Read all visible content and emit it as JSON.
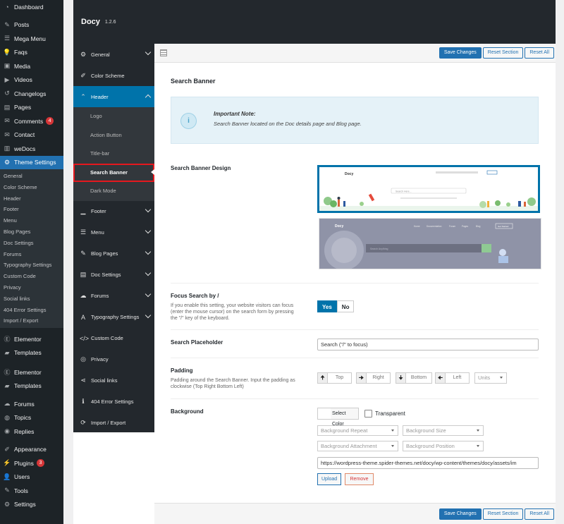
{
  "wp_menu": {
    "items": [
      {
        "label": "Dashboard",
        "icon": "dashboard-icon",
        "glyph": "◔"
      },
      {
        "sep": true
      },
      {
        "label": "Posts",
        "icon": "pin-icon",
        "glyph": "✎"
      },
      {
        "label": "Mega Menu",
        "icon": "menu-icon",
        "glyph": "☰"
      },
      {
        "label": "Faqs",
        "icon": "lightbulb-icon",
        "glyph": "💡"
      },
      {
        "label": "Media",
        "icon": "media-icon",
        "glyph": "▣"
      },
      {
        "label": "Videos",
        "icon": "video-icon",
        "glyph": "▶"
      },
      {
        "label": "Changelogs",
        "icon": "history-icon",
        "glyph": "↺"
      },
      {
        "label": "Pages",
        "icon": "pages-icon",
        "glyph": "▤"
      },
      {
        "label": "Comments",
        "icon": "comments-icon",
        "glyph": "✉",
        "badge": "4"
      },
      {
        "label": "Contact",
        "icon": "mail-icon",
        "glyph": "✉"
      },
      {
        "label": "weDocs",
        "icon": "book-icon",
        "glyph": "▥"
      },
      {
        "label": "Theme Settings",
        "icon": "gear-icon",
        "glyph": "⚙",
        "active": true
      }
    ],
    "theme_submenu": [
      "General",
      "Color Scheme",
      "Header",
      "Footer",
      "Menu",
      "Blog Pages",
      "Doc Settings",
      "Forums",
      "Typography Settings",
      "Custom Code",
      "Privacy",
      "Social links",
      "404 Error Settings",
      "Import / Export"
    ],
    "items_after": [
      {
        "sep": true
      },
      {
        "label": "Elementor",
        "icon": "elementor-icon",
        "glyph": "Ⓔ"
      },
      {
        "label": "Templates",
        "icon": "folder-icon",
        "glyph": "▰"
      },
      {
        "label": "",
        "icon": "cut-item-icon",
        "glyph": "",
        "partial": true
      },
      {
        "label": "Elementor",
        "icon": "elementor-icon",
        "glyph": "Ⓔ"
      },
      {
        "label": "Templates",
        "icon": "folder-icon",
        "glyph": "▰"
      },
      {
        "sep": true
      },
      {
        "label": "Forums",
        "icon": "forums-icon",
        "glyph": "☁"
      },
      {
        "label": "Topics",
        "icon": "topics-icon",
        "glyph": "◍"
      },
      {
        "label": "Replies",
        "icon": "replies-icon",
        "glyph": "◉"
      },
      {
        "sep": true
      },
      {
        "label": "Appearance",
        "icon": "brush-icon",
        "glyph": "✐"
      },
      {
        "label": "Plugins",
        "icon": "plugin-icon",
        "glyph": "⚡",
        "badge": "3"
      },
      {
        "label": "Users",
        "icon": "user-icon",
        "glyph": "👤"
      },
      {
        "label": "Tools",
        "icon": "wrench-icon",
        "glyph": "✎"
      },
      {
        "label": "Settings",
        "icon": "settings-icon",
        "glyph": "⚙"
      }
    ]
  },
  "panel": {
    "title": "Docy",
    "version": "1.2.6"
  },
  "options_nav": {
    "before": [
      {
        "label": "General",
        "icon": "gear-icon",
        "glyph": "⚙",
        "chev": true
      },
      {
        "label": "Color Scheme",
        "icon": "brush-icon",
        "glyph": "✐",
        "chev": false
      }
    ],
    "header": {
      "label": "Header",
      "icon": "chevron-up-icon",
      "glyph": "⌃"
    },
    "header_sub": [
      "Logo",
      "Action Button",
      "Title-bar",
      "Search Banner",
      "Dark Mode"
    ],
    "after": [
      {
        "label": "Footer",
        "icon": "footer-icon",
        "glyph": "▁",
        "chev": true
      },
      {
        "label": "Menu",
        "icon": "menu-icon",
        "glyph": "☰",
        "chev": true
      },
      {
        "label": "Blog Pages",
        "icon": "pin-icon",
        "glyph": "✎",
        "chev": true
      },
      {
        "label": "Doc Settings",
        "icon": "doc-icon",
        "glyph": "▤",
        "chev": true
      },
      {
        "label": "Forums",
        "icon": "forums-icon",
        "glyph": "☁",
        "chev": true
      },
      {
        "label": "Typography Settings",
        "icon": "typography-icon",
        "glyph": "A",
        "chev": true
      },
      {
        "label": "Custom Code",
        "icon": "code-icon",
        "glyph": "</>",
        "chev": false
      },
      {
        "label": "Privacy",
        "icon": "privacy-icon",
        "glyph": "◎",
        "chev": false
      },
      {
        "label": "Social links",
        "icon": "share-icon",
        "glyph": "⋖",
        "chev": false
      },
      {
        "label": "404 Error Settings",
        "icon": "info-icon",
        "glyph": "ℹ",
        "chev": false
      },
      {
        "label": "Import / Export",
        "icon": "refresh-icon",
        "glyph": "⟳",
        "chev": false
      }
    ]
  },
  "toolbar": {
    "save": "Save Changes",
    "reset_section": "Reset Section",
    "reset_all": "Reset All"
  },
  "section_title": "Search Banner",
  "note": {
    "icon": "i",
    "title": "Important Note:",
    "text": "Search Banner located on the Doc details page and Blog page."
  },
  "fields": {
    "design": {
      "label": "Search Banner Design"
    },
    "focus": {
      "label": "Focus Search by /",
      "desc": "If you enable this setting, your website visitors can focus (enter the mouse cursor) on the search form by pressing the \"/\" key of the keyboard.",
      "yes": "Yes",
      "no": "No"
    },
    "placeholder": {
      "label": "Search Placeholder",
      "value": "Search (\"/\" to focus)"
    },
    "padding": {
      "label": "Padding",
      "desc": "Padding around the Search Banner. Input the padding as clockwise (Top Right Bottom Left)",
      "top": "Top",
      "right": "Right",
      "bottom": "Bottom",
      "left": "Left",
      "units": "Units"
    },
    "background": {
      "label": "Background",
      "select_color": "Select Color",
      "transparent": "Transparent",
      "repeat": "Background Repeat",
      "size": "Background Size",
      "attachment": "Background Attachment",
      "position": "Background Position",
      "url": "https://wordpress-theme.spider-themes.net/docy/wp-content/themes/docy/assets/im",
      "upload": "Upload",
      "remove": "Remove"
    }
  },
  "thumb1": {
    "logo": "Docy",
    "search": "Search Here..."
  },
  "thumb2": {
    "logo": "Docy",
    "nav": [
      "Home",
      "Documentation",
      "Forum",
      "Pages",
      "Blog"
    ],
    "cta": "Get Started",
    "search": "Search Anything"
  }
}
